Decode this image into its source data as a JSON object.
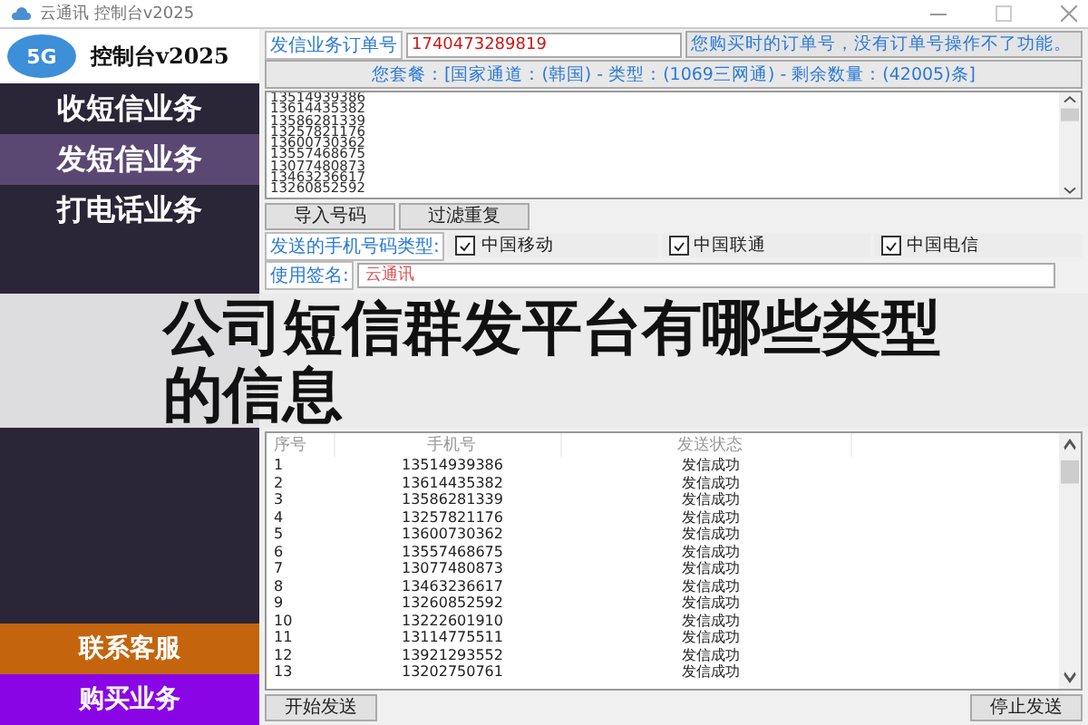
{
  "window": {
    "title": "云通讯 控制台v2025"
  },
  "logo": {
    "badge": "5G",
    "title": "控制台v2025"
  },
  "sidebar": {
    "items": [
      {
        "label": "收短信业务",
        "selected": false
      },
      {
        "label": "发短信业务",
        "selected": true
      },
      {
        "label": "打电话业务",
        "selected": false
      }
    ],
    "bottom_items": [
      {
        "label": "联系客服",
        "color": "#c4650e"
      },
      {
        "label": "购买业务",
        "color": "#8a05e6"
      }
    ]
  },
  "order": {
    "label": "发信业务订单号",
    "value": "1740473289819",
    "hint": "您购买时的订单号，没有订单号操作不了功能。"
  },
  "package": "您套餐：[国家通道：(韩国) - 类型：(1069三网通) - 剩余数量：(42005)条]",
  "numbers": [
    "13514939386",
    "13614435382",
    "13586281339",
    "13257821176",
    "13600730362",
    "13557468675",
    "13077480873",
    "13463236617",
    "13260852592"
  ],
  "number_buttons": [
    "导入号码",
    "过滤重复"
  ],
  "carriers": {
    "label": "发送的手机号码类型:",
    "items": [
      {
        "label": "中国移动",
        "checked": true
      },
      {
        "label": "中国联通",
        "checked": true
      },
      {
        "label": "中国电信",
        "checked": true
      }
    ]
  },
  "signature": {
    "label": "使用签名:",
    "value": "云通讯"
  },
  "overlay_title": "公司短信群发平台有哪些类型的信息",
  "table": {
    "columns": [
      "序号",
      "手机号",
      "发送状态"
    ],
    "rows": [
      [
        "1",
        "13514939386",
        "发信成功"
      ],
      [
        "2",
        "13614435382",
        "发信成功"
      ],
      [
        "3",
        "13586281339",
        "发信成功"
      ],
      [
        "4",
        "13257821176",
        "发信成功"
      ],
      [
        "5",
        "13600730362",
        "发信成功"
      ],
      [
        "6",
        "13557468675",
        "发信成功"
      ],
      [
        "7",
        "13077480873",
        "发信成功"
      ],
      [
        "8",
        "13463236617",
        "发信成功"
      ],
      [
        "9",
        "13260852592",
        "发信成功"
      ],
      [
        "10",
        "13222601910",
        "发信成功"
      ],
      [
        "11",
        "13114775511",
        "发信成功"
      ],
      [
        "12",
        "13921293552",
        "发信成功"
      ],
      [
        "13",
        "13202750761",
        "发信成功"
      ]
    ]
  },
  "send_buttons": [
    "开始发送",
    "停止发送"
  ]
}
